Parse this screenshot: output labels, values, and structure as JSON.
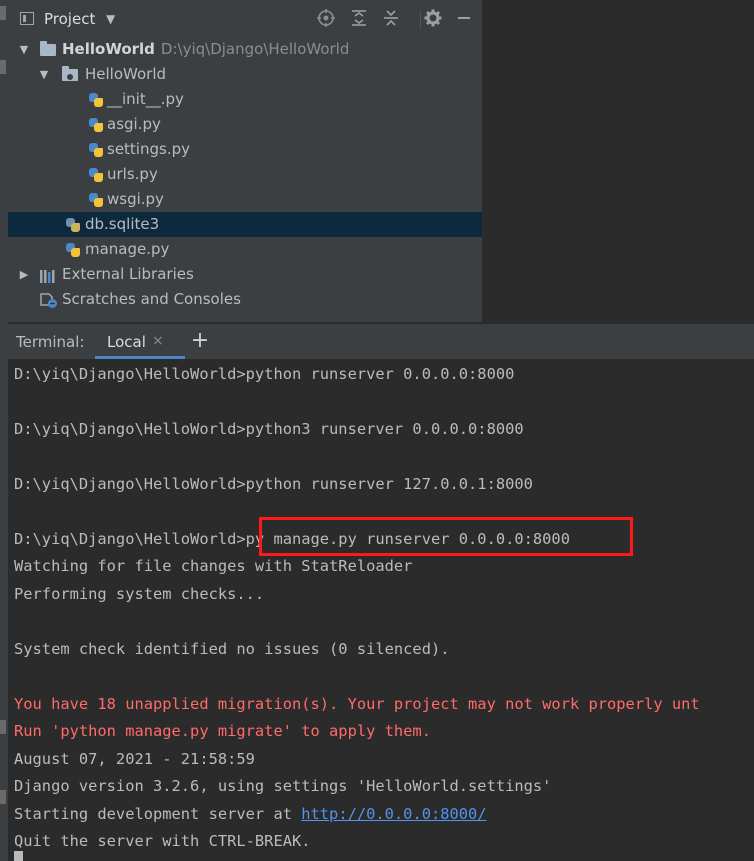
{
  "project_panel": {
    "title": "Project",
    "tree": [
      {
        "label": "HelloWorld",
        "path": "D:\\yiq\\Django\\HelloWorld",
        "type": "root-folder"
      },
      {
        "label": "HelloWorld",
        "type": "package"
      },
      {
        "label": "__init__.py",
        "type": "python-file"
      },
      {
        "label": "asgi.py",
        "type": "python-file"
      },
      {
        "label": "settings.py",
        "type": "python-file"
      },
      {
        "label": "urls.py",
        "type": "python-file"
      },
      {
        "label": "wsgi.py",
        "type": "python-file"
      },
      {
        "label": "db.sqlite3",
        "type": "database-file",
        "selected": true
      },
      {
        "label": "manage.py",
        "type": "python-file"
      },
      {
        "label": "External Libraries",
        "type": "libraries"
      },
      {
        "label": "Scratches and Consoles",
        "type": "scratches"
      }
    ],
    "toolbar_icons": [
      "target-icon",
      "expand-all-icon",
      "collapse-all-icon",
      "gear-icon",
      "minimize-icon"
    ]
  },
  "terminal": {
    "label": "Terminal:",
    "active_tab": "Local",
    "close_symbol": "×",
    "add_symbol": "+",
    "lines": [
      {
        "text": "D:\\yiq\\Django\\HelloWorld>python runserver 0.0.0.0:8000",
        "kind": "normal"
      },
      {
        "text": "D:\\yiq\\Django\\HelloWorld>python3 runserver 0.0.0.0:8000",
        "kind": "normal"
      },
      {
        "text": "D:\\yiq\\Django\\HelloWorld>python runserver 127.0.0.1:8000",
        "kind": "normal"
      },
      {
        "text": "D:\\yiq\\Django\\HelloWorld>py manage.py runserver 0.0.0.0:8000",
        "kind": "normal"
      },
      {
        "text": "Watching for file changes with StatReloader",
        "kind": "normal"
      },
      {
        "text": "Performing system checks...",
        "kind": "normal"
      },
      {
        "text": "System check identified no issues (0 silenced).",
        "kind": "normal"
      },
      {
        "text": "You have 18 unapplied migration(s). Your project may not work properly unt",
        "kind": "error"
      },
      {
        "text": "Run 'python manage.py migrate' to apply them.",
        "kind": "error"
      },
      {
        "text": "August 07, 2021 - 21:58:59",
        "kind": "normal"
      },
      {
        "text": "Django version 3.2.6, using settings 'HelloWorld.settings'",
        "kind": "normal"
      },
      {
        "text_before": "Starting development server at ",
        "link": "http://0.0.0.0:8000/",
        "kind": "link"
      },
      {
        "text": "Quit the server with CTRL-BREAK.",
        "kind": "normal"
      }
    ]
  },
  "colors": {
    "background": "#2b2b2b",
    "panel": "#3c3f41",
    "selection": "#0d293e",
    "error_text": "#ff6b68",
    "link": "#5394ec",
    "highlight_box": "#ff1a1a"
  }
}
